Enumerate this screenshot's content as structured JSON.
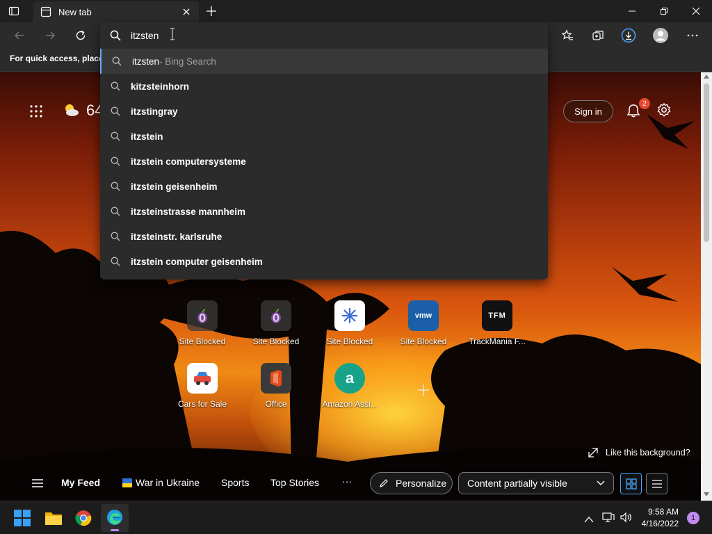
{
  "tab": {
    "title": "New tab"
  },
  "omnibox": {
    "query": "itzsten",
    "top_suggestion": {
      "text": "itzsten",
      "suffix": " - Bing Search"
    },
    "suggestions": [
      "kitzsteinhorn",
      "itzstingray",
      "itzstein",
      "itzstein computersysteme",
      "itzstein geisenheim",
      "itzsteinstrasse mannheim",
      "itzsteinstr. karlsruhe",
      "itzstein computer geisenheim"
    ]
  },
  "favbar": {
    "text": "For quick access, place y"
  },
  "weather": {
    "temp": "64"
  },
  "header": {
    "sign_in": "Sign in",
    "notif_count": "2"
  },
  "tiles": [
    {
      "label": "Site Blocked",
      "icon": "tor-icon"
    },
    {
      "label": "Site Blocked",
      "icon": "tor-icon"
    },
    {
      "label": "Site Blocked",
      "icon": "snowflake-icon"
    },
    {
      "label": "Site Blocked",
      "icon": "vmware-icon",
      "glyph": "vmw"
    },
    {
      "label": "TrackMania F...",
      "icon": "trackmania-icon",
      "glyph": "TFM"
    },
    {
      "label": "Cars for Sale",
      "icon": "car-icon"
    },
    {
      "label": "Office",
      "icon": "office-icon"
    },
    {
      "label": "Amazon Assi...",
      "icon": "amazon-assistant-icon",
      "glyph": "a"
    }
  ],
  "background_prompt": "Like this background?",
  "feed": {
    "my_feed": "My Feed",
    "items": [
      "War in Ukraine",
      "Sports",
      "Top Stories"
    ],
    "more": "···",
    "personalize": "Personalize",
    "visibility": "Content partially visible"
  },
  "taskbar": {
    "time": "9:58 AM",
    "date": "4/16/2022",
    "badge": "1"
  },
  "colors": {
    "accent": "#0078d4",
    "notif": "#e8482f",
    "chat_badge": "#c18af0"
  }
}
